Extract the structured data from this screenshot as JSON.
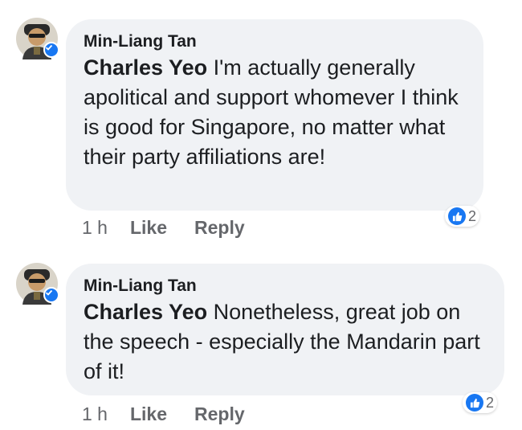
{
  "comments": [
    {
      "author": "Min-Liang Tan",
      "mention": "Charles Yeo",
      "text": " I'm actually generally apolitical and support whomever I think is good for Singapore, no matter what their party affiliations are!",
      "time": "1 h",
      "like_label": "Like",
      "reply_label": "Reply",
      "reaction_count": "2"
    },
    {
      "author": "Min-Liang Tan",
      "mention": "Charles Yeo",
      "text": " Nonetheless, great job on the speech - especially the Mandarin part of it!",
      "time": "1 h",
      "like_label": "Like",
      "reply_label": "Reply",
      "reaction_count": "2"
    }
  ],
  "colors": {
    "accent": "#1877f2",
    "bubble": "#f0f2f5",
    "muted": "#65676b"
  },
  "icons": {
    "avatar": "avatar",
    "verified": "verified-badge-icon",
    "reaction": "like-reaction-icon"
  }
}
